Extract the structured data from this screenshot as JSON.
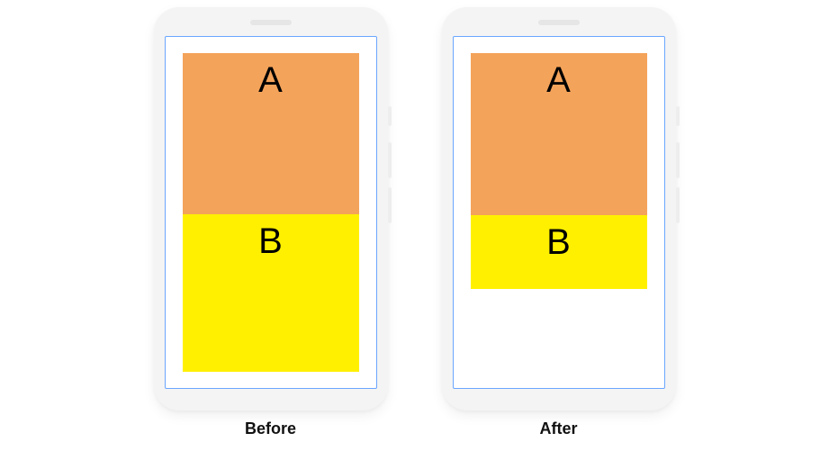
{
  "left": {
    "caption": "Before",
    "blockA": {
      "label": "A",
      "color": "#f4a35a"
    },
    "blockB": {
      "label": "B",
      "color": "#fff000"
    }
  },
  "right": {
    "caption": "After",
    "blockA": {
      "label": "A",
      "color": "#f4a35a"
    },
    "blockB": {
      "label": "B",
      "color": "#fff000"
    }
  }
}
